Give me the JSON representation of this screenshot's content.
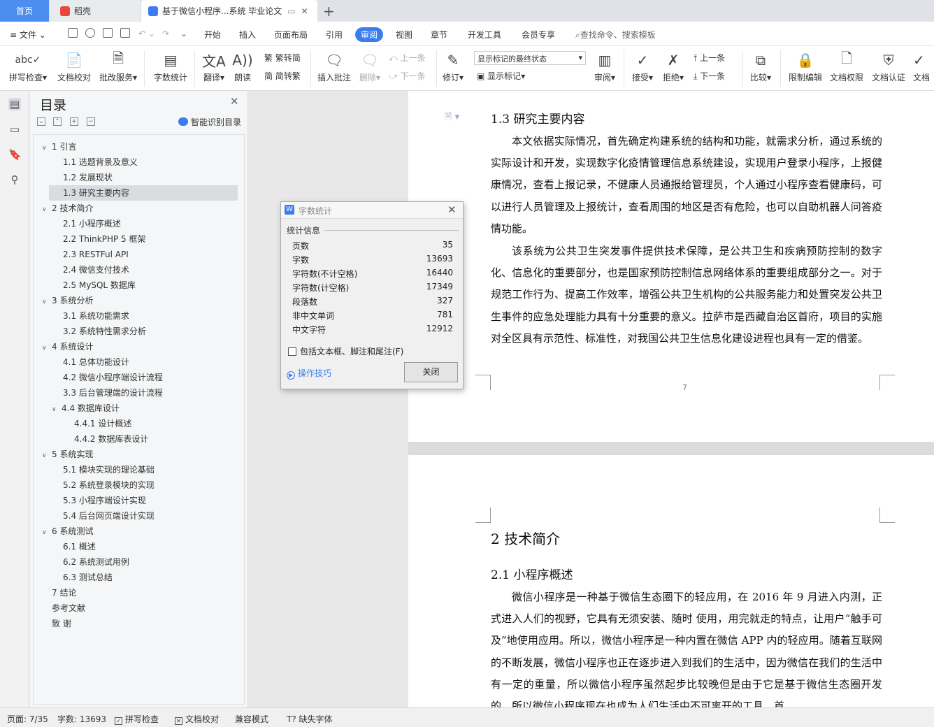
{
  "tabs": {
    "home": "首页",
    "daoke": "稻壳",
    "doc": "基于微信小程序...系统 毕业论文"
  },
  "menu": {
    "file": "文件",
    "items": [
      "开始",
      "插入",
      "页面布局",
      "引用",
      "审阅",
      "视图",
      "章节",
      "开发工具",
      "会员专享"
    ],
    "active": "审阅",
    "search": "查找命令、搜索模板"
  },
  "ribbon": {
    "spellcheck": "拼写检查",
    "doccheck": "文档校对",
    "batch": "批改服务",
    "wordcount": "字数统计",
    "translate": "翻译",
    "read": "朗读",
    "trad": "繁转简",
    "simp": "简转繁",
    "insert_comment": "插入批注",
    "delete": "删除",
    "prev1": "上一条",
    "next1": "下一条",
    "revise": "修订",
    "mark_state": "显示标记的最终状态",
    "show_marks": "显示标记",
    "review": "审阅",
    "accept": "接受",
    "reject": "拒绝",
    "prev2": "上一条",
    "next2": "下一条",
    "compare": "比较",
    "restrict": "限制编辑",
    "perm": "文档权限",
    "auth": "文档认证",
    "last": "文档"
  },
  "toc": {
    "title": "目录",
    "smart": "智能识别目录",
    "items": [
      {
        "text": "1  引言",
        "level": 1
      },
      {
        "text": "1.1  选题背景及意义",
        "level": 2
      },
      {
        "text": "1.2  发展现状",
        "level": 2
      },
      {
        "text": "1.3  研究主要内容",
        "level": 2,
        "selected": true
      },
      {
        "text": "2  技术简介",
        "level": 1
      },
      {
        "text": "2.1  小程序概述",
        "level": 2
      },
      {
        "text": "2.2 ThinkPHP 5  框架",
        "level": 2
      },
      {
        "text": "2.3 RESTFul API",
        "level": 2
      },
      {
        "text": "2.4  微信支付技术",
        "level": 2
      },
      {
        "text": "2.5 MySQL 数据库",
        "level": 2
      },
      {
        "text": "3  系统分析",
        "level": 1
      },
      {
        "text": "3.1  系统功能需求",
        "level": 2
      },
      {
        "text": "3.2  系统特性需求分析",
        "level": 2
      },
      {
        "text": "4  系统设计",
        "level": 1
      },
      {
        "text": "4.1  总体功能设计",
        "level": 2
      },
      {
        "text": "4.2  微信小程序端设计流程",
        "level": 2
      },
      {
        "text": "3.3  后台管理端的设计流程",
        "level": 2
      },
      {
        "text": "4.4  数据库设计",
        "level": 2,
        "expandable": true
      },
      {
        "text": "4.4.1  设计概述",
        "level": 3
      },
      {
        "text": "4.4.2  数据库表设计",
        "level": 3
      },
      {
        "text": "5  系统实现",
        "level": 1
      },
      {
        "text": "5.1  模块实现的理论基础",
        "level": 2
      },
      {
        "text": "5.2  系统登录模块的实现",
        "level": 2
      },
      {
        "text": "5.3  小程序端设计实现",
        "level": 2
      },
      {
        "text": "5.4  后台网页端设计实现",
        "level": 2
      },
      {
        "text": "6  系统测试",
        "level": 1
      },
      {
        "text": "6.1  概述",
        "level": 2
      },
      {
        "text": "6.2  系统测试用例",
        "level": 2
      },
      {
        "text": "6.3  测试总结",
        "level": 2
      },
      {
        "text": "7  结论",
        "level": 0
      },
      {
        "text": "参考文献",
        "level": 0
      },
      {
        "text": "致    谢",
        "level": 0
      }
    ]
  },
  "document": {
    "p1_heading": "1.3  研究主要内容",
    "p1_para1": "本文依据实际情况，首先确定构建系统的结构和功能，就需求分析，通过系统的实际设计和开发，实现数字化疫情管理信息系统建设，实现用户登录小程序，上报健康情况，查看上报记录，不健康人员通报给管理员，个人通过小程序查看健康码，可以进行人员管理及上报统计，查看周围的地区是否有危险，也可以自助机器人问答疫情功能。",
    "p1_para2": "该系统为公共卫生突发事件提供技术保障，是公共卫生和疾病预防控制的数字化、信息化的重要部分，也是国家预防控制信息网络体系的重要组成部分之一。对于规范工作行为、提高工作效率，增强公共卫生机构的公共服务能力和处置突发公共卫生事件的应急处理能力具有十分重要的意义。拉萨市是西藏自治区首府，项目的实施对全区具有示范性、标准性，对我国公共卫生信息化建设进程也具有一定的借鉴。",
    "page_number": "7",
    "p2_h1": "2  技术简介",
    "p2_h2": "2.1  小程序概述",
    "p2_para": "微信小程序是一种基于微信生态圈下的轻应用，在 2016 年 9 月进入内测，正式进入人们的视野，它具有无须安装、随时 使用，用完就走的特点，让用户“触手可及”地使用应用。所以，微信小程序是一种内置在微信 APP 内的轻应用。随着互联网的不断发展，微信小程序也正在逐步进入到我们的生活中，因为微信在我们的生活中有一定的重量，所以微信小程序虽然起步比较晚但是由于它是基于微信生态圈开发的，所以微信小程序现在也成为人们生活中不可离开的工具，首"
  },
  "dialog": {
    "title": "字数统计",
    "section": "统计信息",
    "stats": [
      {
        "label": "页数",
        "value": "35"
      },
      {
        "label": "字数",
        "value": "13693"
      },
      {
        "label": "字符数(不计空格)",
        "value": "16440"
      },
      {
        "label": "字符数(计空格)",
        "value": "17349"
      },
      {
        "label": "段落数",
        "value": "327"
      },
      {
        "label": "非中文单词",
        "value": "781"
      },
      {
        "label": "中文字符",
        "value": "12912"
      }
    ],
    "checkbox": "包括文本框、脚注和尾注(F)",
    "tips": "操作技巧",
    "close": "关闭"
  },
  "status": {
    "page": "页面: 7/35",
    "words": "字数: 13693",
    "spell": "拼写检查",
    "proof": "文档校对",
    "compat": "兼容模式",
    "font": "缺失字体"
  },
  "colors": {
    "accent": "#3b7df0",
    "daoke": "#e8473b"
  }
}
